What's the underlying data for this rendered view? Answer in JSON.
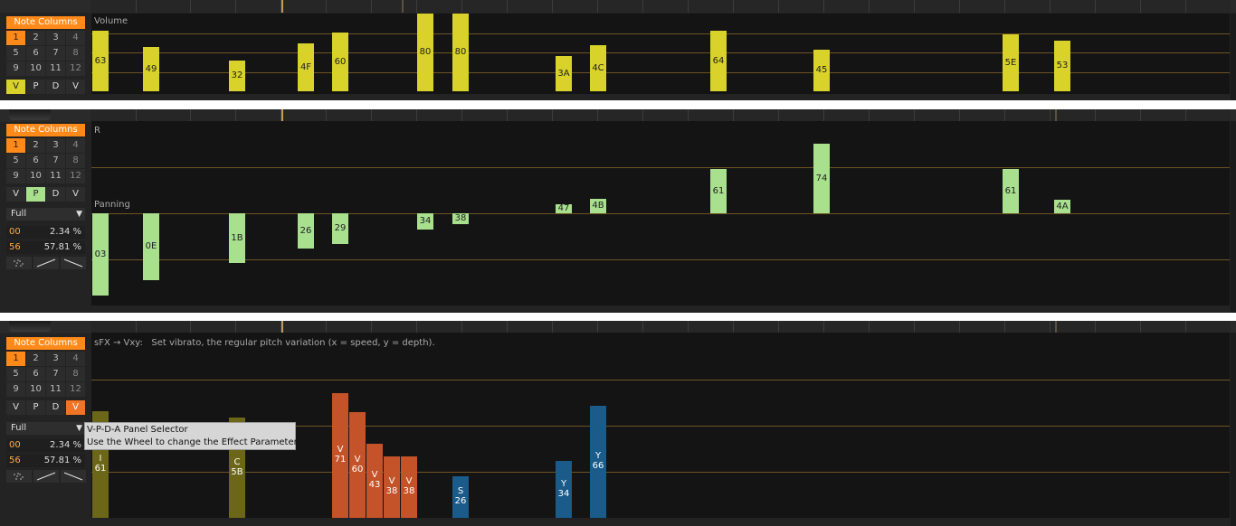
{
  "colors": {
    "volume": "#d9d22a",
    "panning": "#a8e08e",
    "note_columns": "#ff8a1a",
    "fx_vibrato": "#c4532a",
    "fx_y": "#1a5b8a",
    "fx_olive": "#6b6618",
    "fx_s": "#1a5b8a",
    "grid_line": "#6d5322"
  },
  "panel1": {
    "note_columns_label": "Note Columns",
    "columns": [
      "1",
      "2",
      "3",
      "4",
      "5",
      "6",
      "7",
      "8",
      "9",
      "10",
      "11",
      "12"
    ],
    "modes": [
      "V",
      "P",
      "D",
      "V"
    ],
    "area_label": "Volume",
    "bars": [
      {
        "label": "63",
        "value": 99
      },
      {
        "label": "49",
        "value": 73
      },
      {
        "label": "32",
        "value": 50
      },
      {
        "label": "4F",
        "value": 79
      },
      {
        "label": "60",
        "value": 96
      },
      {
        "label": "80",
        "value": 128
      },
      {
        "label": "80",
        "value": 128
      },
      {
        "label": "3A",
        "value": 58
      },
      {
        "label": "4C",
        "value": 76
      },
      {
        "label": "64",
        "value": 100
      },
      {
        "label": "45",
        "value": 69
      },
      {
        "label": "5E",
        "value": 94
      },
      {
        "label": "53",
        "value": 83
      }
    ]
  },
  "panel2": {
    "note_columns_label": "Note Columns",
    "columns": [
      "1",
      "2",
      "3",
      "4",
      "5",
      "6",
      "7",
      "8",
      "9",
      "10",
      "11",
      "12"
    ],
    "modes": [
      "V",
      "P",
      "D",
      "V"
    ],
    "selector": "Full",
    "row1": {
      "key": "00",
      "value": "2.34 %"
    },
    "row2": {
      "key": "56",
      "value": "57.81 %"
    },
    "top_label": "R",
    "area_label": "Panning",
    "bars": [
      {
        "label": "03",
        "value": 3
      },
      {
        "label": "0E",
        "value": 14
      },
      {
        "label": "1B",
        "value": 27
      },
      {
        "label": "26",
        "value": 38
      },
      {
        "label": "29",
        "value": 41
      },
      {
        "label": "34",
        "value": 52
      },
      {
        "label": "38",
        "value": 56
      },
      {
        "label": "47",
        "value": 71
      },
      {
        "label": "4B",
        "value": 75
      },
      {
        "label": "61",
        "value": 97
      },
      {
        "label": "74",
        "value": 116
      },
      {
        "label": "61",
        "value": 97
      },
      {
        "label": "4A",
        "value": 74
      }
    ]
  },
  "panel3": {
    "note_columns_label": "Note Columns",
    "columns": [
      "1",
      "2",
      "3",
      "4",
      "5",
      "6",
      "7",
      "8",
      "9",
      "10",
      "11",
      "12"
    ],
    "modes": [
      "V",
      "P",
      "D",
      "V"
    ],
    "selector": "Full",
    "row1": {
      "key": "00",
      "value": "2.34 %"
    },
    "row2": {
      "key": "56",
      "value": "57.81 %"
    },
    "fx_info": "sFX → Vxy:   Set vibrato, the regular pitch variation (x = speed, y = depth).",
    "fx_bars": [
      {
        "letter": "I",
        "value": "61",
        "color": "olive"
      },
      {
        "letter": "C",
        "value": "5B",
        "color": "olive"
      },
      {
        "letter": "V",
        "value": "71",
        "color": "vib"
      },
      {
        "letter": "V",
        "value": "60",
        "color": "vib"
      },
      {
        "letter": "V",
        "value": "43",
        "color": "vib"
      },
      {
        "letter": "V",
        "value": "38",
        "color": "vib"
      },
      {
        "letter": "V",
        "value": "38",
        "color": "vib"
      },
      {
        "letter": "S",
        "value": "26",
        "color": "blue"
      },
      {
        "letter": "Y",
        "value": "34",
        "color": "blue"
      },
      {
        "letter": "Y",
        "value": "66",
        "color": "blue"
      }
    ],
    "tooltip": {
      "line1": "V-P-D-A Panel Selector",
      "line2": "Use the Wheel to change the Effect Parameter."
    }
  }
}
